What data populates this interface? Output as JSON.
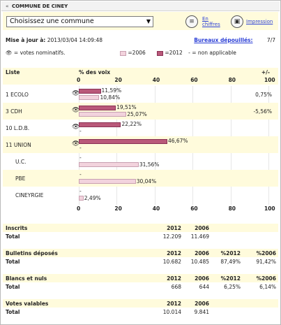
{
  "window": {
    "title": "COMMUNE DE CINEY"
  },
  "toolbar": {
    "select_value": "Choisissez une commune",
    "en_chiffres": [
      "En",
      "chiffres"
    ],
    "impression": "Impression"
  },
  "meta": {
    "updated_label": "Mise à jour à:",
    "updated_value": "2013/03/04 14:09:48",
    "bureaux_label": "Bureaux dépouillés:",
    "bureaux_value": "7/7"
  },
  "legend": {
    "nominatifs": "= votes nominatifs.",
    "y2006": "=2006",
    "y2012": "=2012",
    "na": "- = non applicable",
    "color_2006": "#f2d3dd",
    "color_2012": "#b9597a"
  },
  "table_header": {
    "liste": "Liste",
    "pct": "% des voix",
    "diff": "+/-",
    "ticks": [
      "0",
      "20",
      "40",
      "60",
      "80",
      "100"
    ]
  },
  "chart_data": {
    "type": "bar",
    "xlim": [
      0,
      100
    ],
    "categories": [
      "1 ECOLO",
      "3 CDH",
      "10 L.D.B.",
      "11 UNION",
      "U.C.",
      "PBE",
      "CINEYRGIE"
    ],
    "series": [
      {
        "name": "2012",
        "values": [
          11.59,
          19.51,
          22.22,
          46.67,
          null,
          null,
          null
        ]
      },
      {
        "name": "2006",
        "values": [
          10.84,
          25.07,
          null,
          null,
          31.56,
          30.04,
          2.49
        ]
      }
    ],
    "diff": [
      "0,75%",
      "-5,56%",
      "",
      "",
      "",
      "",
      ""
    ]
  },
  "rows": [
    {
      "name": "1   ECOLO",
      "ico": true,
      "indent": false,
      "v12": 11.59,
      "l12": "11,59%",
      "v06": 10.84,
      "l06": "10,84%",
      "diff": "0,75%"
    },
    {
      "name": "3   CDH",
      "ico": true,
      "indent": false,
      "v12": 19.51,
      "l12": "19,51%",
      "v06": 25.07,
      "l06": "25,07%",
      "diff": "-5,56%"
    },
    {
      "name": "10  L.D.B.",
      "ico": true,
      "indent": false,
      "v12": 22.22,
      "l12": "22,22%",
      "v06": null,
      "l06": "-",
      "diff": ""
    },
    {
      "name": "11  UNION",
      "ico": true,
      "indent": false,
      "v12": 46.67,
      "l12": "46,67%",
      "v06": null,
      "l06": "-",
      "diff": ""
    },
    {
      "name": "U.C.",
      "ico": false,
      "indent": true,
      "v12": null,
      "l12": "-",
      "v06": 31.56,
      "l06": "31,56%",
      "diff": ""
    },
    {
      "name": "PBE",
      "ico": false,
      "indent": true,
      "v12": null,
      "l12": "-",
      "v06": 30.04,
      "l06": "30,04%",
      "diff": ""
    },
    {
      "name": "CINEYRGIE",
      "ico": false,
      "indent": true,
      "v12": null,
      "l12": "-",
      "v06": 2.49,
      "l06": "2,49%",
      "diff": ""
    }
  ],
  "stats": {
    "inscrits": {
      "title": "Inscrits",
      "h1": "2012",
      "h2": "2006",
      "total": "Total",
      "v1": "12.209",
      "v2": "11.469"
    },
    "bulletins": {
      "title": "Bulletins  déposés",
      "h1": "2012",
      "h2": "2006",
      "h3": "%2012",
      "h4": "%2006",
      "total": "Total",
      "v1": "10.682",
      "v2": "10.485",
      "v3": "87,49%",
      "v4": "91,42%"
    },
    "blancs": {
      "title": "Blancs et nuls",
      "h1": "2012",
      "h2": "2006",
      "h3": "%2012",
      "h4": "%2006",
      "total": "Total",
      "v1": "668",
      "v2": "644",
      "v3": "6,25%",
      "v4": "6,14%"
    },
    "valables": {
      "title": "Votes valables",
      "h1": "2012",
      "h2": "2006",
      "total": "Total",
      "v1": "10.014",
      "v2": "9.841"
    }
  }
}
